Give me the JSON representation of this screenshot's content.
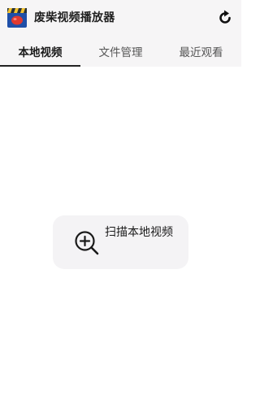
{
  "app": {
    "title": "废柴视频播放器",
    "icon": "clapperboard-icon",
    "refresh_icon": "refresh-icon"
  },
  "tabs": [
    {
      "label": "本地视频",
      "active": true
    },
    {
      "label": "文件管理",
      "active": false
    },
    {
      "label": "最近观看",
      "active": false
    }
  ],
  "main": {
    "scan_button_label": "扫描本地视频",
    "scan_icon": "zoom-in-icon"
  },
  "colors": {
    "appbar_bg": "#f6f5f6",
    "tab_indicator": "#222222",
    "button_bg": "#f4f3f5",
    "logo_red": "#e0392f",
    "logo_blue": "#1f4fa8"
  }
}
